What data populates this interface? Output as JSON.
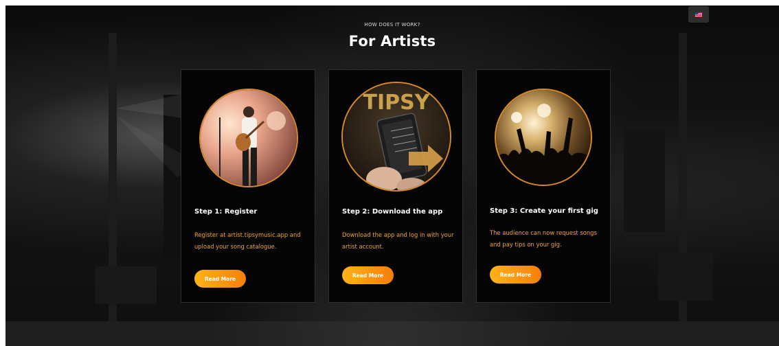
{
  "section": {
    "eyebrow": "HOW DOES IT WORK?",
    "title": "For Artists"
  },
  "language": {
    "flag_icon": "us-flag-icon"
  },
  "cards": [
    {
      "title": "Step 1: Register",
      "description": "Register at artist.tipsymusic.app and upload your song catalogue.",
      "button": "Read More",
      "image_icon": "guitarist-photo"
    },
    {
      "title": "Step 2: Download the app",
      "description": "Download the app and log in with your artist account.",
      "button": "Read More",
      "image_icon": "phone-app-photo",
      "image_text": "TIPSY"
    },
    {
      "title": "Step 3: Create your first gig",
      "description": "The audience can now request songs and pay tips on your gig.",
      "button": "Read More",
      "image_icon": "crowd-photo"
    }
  ],
  "colors": {
    "accent": "#f0a53a",
    "button_start": "#ffb21a",
    "button_end": "#f57f0a",
    "circle_border": "#d98a2a",
    "card_bg": "#050505"
  }
}
